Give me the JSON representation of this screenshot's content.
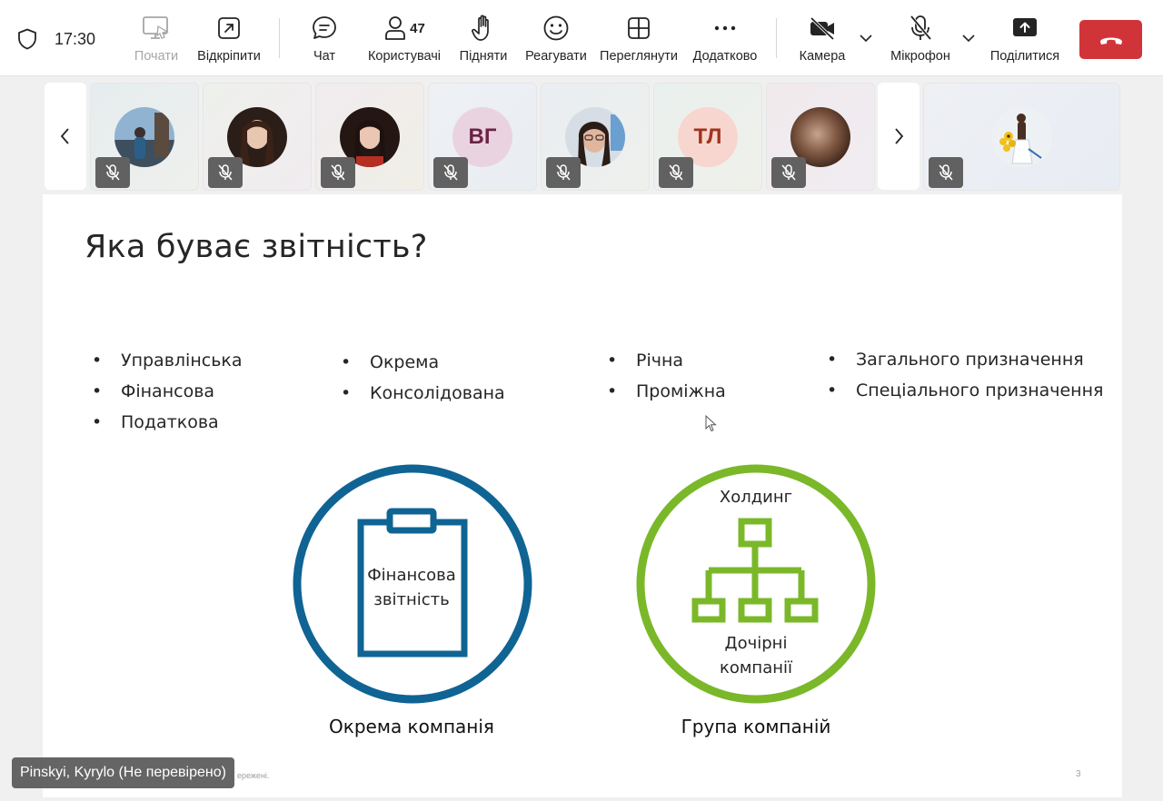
{
  "toolbar": {
    "clock": "17:30",
    "start_label": "Почати",
    "popout_label": "Відкріпити",
    "chat_label": "Чат",
    "people_label": "Користувачі",
    "people_count": "47",
    "raise_label": "Підняти",
    "react_label": "Реагувати",
    "view_label": "Переглянути",
    "more_label": "Додатково",
    "camera_label": "Камера",
    "mic_label": "Мікрофон",
    "share_label": "Поділитися",
    "leave_color": "#d13438"
  },
  "participants": [
    {
      "avatar": "photo",
      "icon": "photo-landscape-person",
      "muted": true
    },
    {
      "avatar": "photo",
      "icon": "photo-woman-dark-hair",
      "muted": true
    },
    {
      "avatar": "photo",
      "icon": "photo-woman-dark-hair",
      "muted": true
    },
    {
      "avatar": "initials",
      "initials": "ВГ",
      "color": "#6b2344",
      "bg": "#ead3e0",
      "muted": true
    },
    {
      "avatar": "photo",
      "icon": "photo-woman-glasses",
      "muted": true
    },
    {
      "avatar": "initials",
      "initials": "ТЛ",
      "color": "#a0341e",
      "bg": "#f7d6cf",
      "muted": true
    },
    {
      "avatar": "photo",
      "icon": "photo-abstract-brown",
      "muted": true
    },
    {
      "avatar": "photo",
      "icon": "photo-girl-sunflowers",
      "muted": true
    }
  ],
  "slide": {
    "title": "Яка буває звітність?",
    "col1": [
      "Управлінська",
      "Фінансова",
      "Податкова"
    ],
    "col2": [
      "Окрема",
      "Консолідована"
    ],
    "col3": [
      "Річна",
      "Проміжна"
    ],
    "col4": [
      "Загального призначення",
      "Спеціального призначення"
    ],
    "left_circle_line1": "Фінансова",
    "left_circle_line2": "звітність",
    "left_caption": "Окрема компанія",
    "right_top": "Холдинг",
    "right_bottom_line1": "Дочірні",
    "right_bottom_line2": "компанії",
    "right_caption": "Група компаній",
    "footer_note": "ережені.",
    "page_number": "3",
    "blue": "#0f6494",
    "green": "#7ab829"
  },
  "presenter": "Pinskyi, Kyrylo (Не перевірено)"
}
